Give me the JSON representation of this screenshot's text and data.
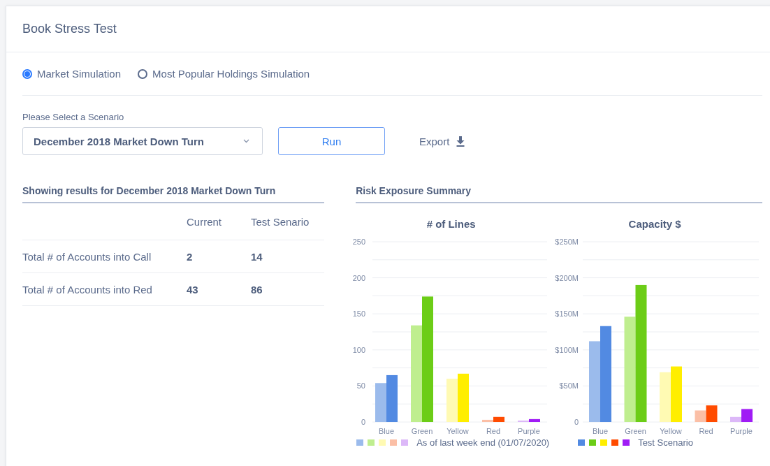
{
  "title": "Book Stress Test",
  "simulations": [
    {
      "label": "Market Simulation",
      "selected": true
    },
    {
      "label": "Most Popular Holdings Simulation",
      "selected": false
    }
  ],
  "scenario": {
    "label": "Please Select a Scenario",
    "value": "December 2018 Market Down Turn"
  },
  "run_button": "Run",
  "export_button": "Export",
  "results": {
    "title": "Showing results for December 2018 Market Down Turn",
    "columns": [
      "Current",
      "Test Senario"
    ],
    "rows": [
      {
        "label": "Total # of Accounts into Call",
        "current": "2",
        "test": "14"
      },
      {
        "label": "Total # of Accounts into Red",
        "current": "43",
        "test": "86"
      }
    ]
  },
  "risk_summary": {
    "title": "Risk Exposure Summary",
    "charts": [
      {
        "chart_data": {
          "type": "bar",
          "title": "# of Lines",
          "grid": true,
          "categories": [
            "Blue",
            "Green",
            "Yellow",
            "Red",
            "Purple"
          ],
          "ylim": [
            0,
            250
          ],
          "yticks": [
            0,
            50,
            100,
            150,
            200,
            250
          ],
          "series": [
            {
              "name": "As of last week end (01/07/2020)",
              "colors": [
                "#9bbbec",
                "#bfee8f",
                "#fffab3",
                "#fbbfa6",
                "#dcb8f8"
              ],
              "values": [
                54,
                134,
                60,
                3,
                2
              ]
            },
            {
              "colors": [
                "#528ae2",
                "#6ccd17",
                "#ffee00",
                "#ff4b00",
                "#a01cf5"
              ],
              "values": [
                65,
                174,
                67,
                7,
                4
              ]
            }
          ]
        }
      },
      {
        "chart_data": {
          "type": "bar",
          "title": "Capacity $",
          "grid": true,
          "categories": [
            "Blue",
            "Green",
            "Yellow",
            "Red",
            "Purple"
          ],
          "ylim": [
            0,
            250
          ],
          "yticks": [
            0,
            {
              "value": 50,
              "label": "$50M"
            },
            {
              "value": 100,
              "label": "$100M"
            },
            {
              "value": 150,
              "label": "$150M"
            },
            {
              "value": 200,
              "label": "$200M"
            },
            {
              "value": 250,
              "label": "$250M"
            }
          ],
          "series": [
            {
              "colors": [
                "#9bbbec",
                "#bfee8f",
                "#fffab3",
                "#fbbfa6",
                "#dcb8f8"
              ],
              "values": [
                112,
                146,
                69,
                16,
                7
              ]
            },
            {
              "name": "Test Scenario",
              "colors": [
                "#528ae2",
                "#6ccd17",
                "#ffee00",
                "#ff4b00",
                "#a01cf5"
              ],
              "values": [
                133,
                190,
                77,
                23,
                18
              ]
            }
          ]
        }
      }
    ]
  }
}
